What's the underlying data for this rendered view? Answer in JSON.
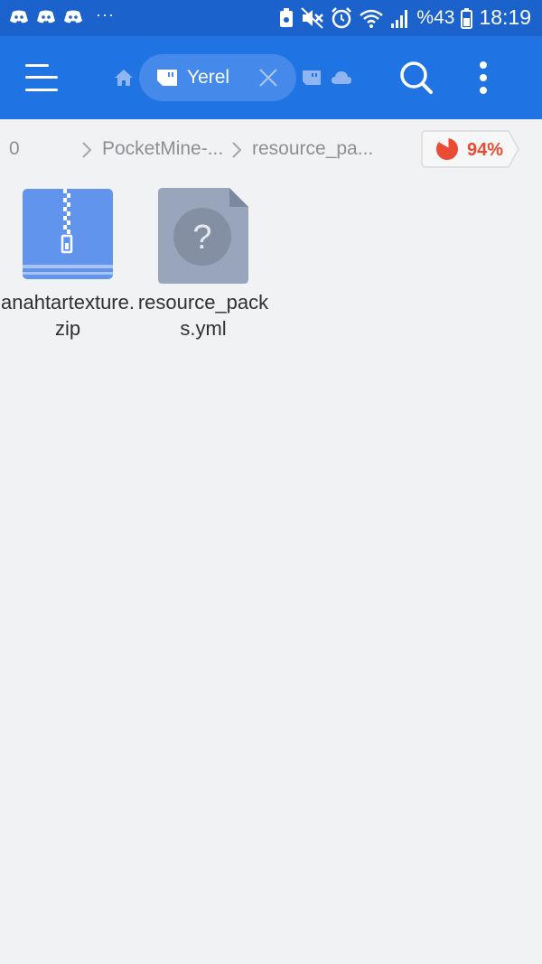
{
  "status_bar": {
    "time": "18:19",
    "battery_percent": "%43",
    "overflow": "···",
    "icons": [
      "discord-icon",
      "discord-icon",
      "discord-icon",
      "vpn-lock-icon",
      "mute-icon",
      "alarm-icon",
      "wifi-icon",
      "signal-icon",
      "battery-icon"
    ]
  },
  "app_bar": {
    "tab_label": "Yerel",
    "icons": [
      "menu-icon",
      "home-icon",
      "sd-card-icon",
      "close-icon",
      "storage-icon",
      "cloud-icon",
      "search-icon",
      "more-icon"
    ]
  },
  "path_bar": {
    "crumbs": [
      "0",
      "PocketMine-...",
      "resource_pa..."
    ],
    "usage": "94%"
  },
  "files": [
    {
      "name": "anahtartexture.zip",
      "type": "zip"
    },
    {
      "name": "resource_packs.yml",
      "type": "unknown"
    }
  ],
  "colors": {
    "status_bar": "#1b62cc",
    "app_bar": "#1f73e3",
    "tab_pill": "#4589ea",
    "background": "#f1f2f4",
    "usage_red": "#ea4b35",
    "zip_blue": "#6194ec",
    "unknown_gray": "#99a5bb"
  }
}
